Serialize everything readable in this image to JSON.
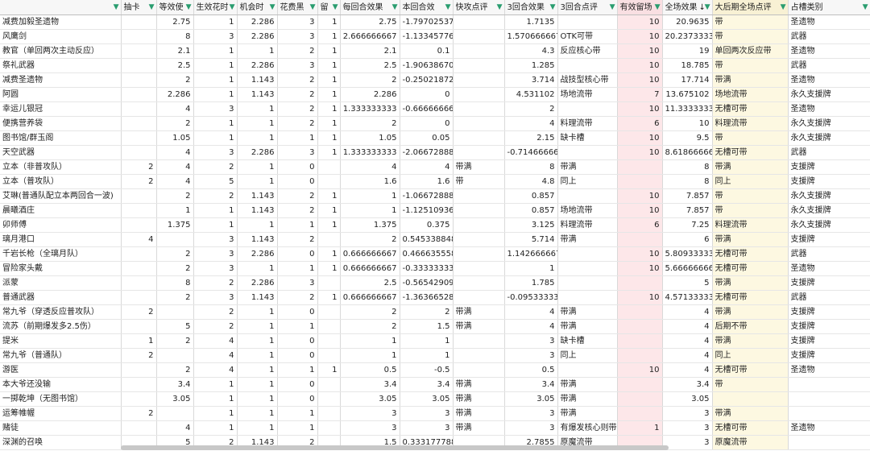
{
  "headers": [
    "",
    "抽卡",
    "等效使",
    "生效花时",
    "机会时",
    "花费黑",
    "留",
    "每回合效果",
    "本回合效",
    "快攻点评",
    "3回合效果",
    "3回合点评",
    "有效留场",
    "全场效果",
    "大后期全场点评",
    "占槽类别"
  ],
  "sort_indicator": "↓",
  "filter_icon": "▼",
  "rows": [
    [
      "减费加毅圣遗物",
      "",
      "2.75",
      "1",
      "2.286",
      "3",
      "1",
      "2.75",
      "-1.797025372",
      "",
      "1.7135",
      "",
      "10",
      "20.9635",
      "带",
      "圣遗物"
    ],
    [
      "风鹰剑",
      "",
      "8",
      "3",
      "2.286",
      "3",
      "1",
      "2.666666667",
      "-1.133457769",
      "",
      "1.570666667",
      "OTK可带",
      "10",
      "20.23733333",
      "带",
      "武器"
    ],
    [
      "教官（单回两次主动反应）",
      "",
      "2.1",
      "1",
      "1",
      "2",
      "1",
      "2.1",
      "0.1",
      "",
      "4.3",
      "反应核心带",
      "10",
      "19",
      "单回两次反应带",
      "圣遗物"
    ],
    [
      "祭礼武器",
      "",
      "2.5",
      "1",
      "2.286",
      "3",
      "1",
      "2.5",
      "-1.906386702",
      "",
      "1.285",
      "",
      "10",
      "18.785",
      "带",
      "武器"
    ],
    [
      "减费圣遗物",
      "",
      "2",
      "1",
      "1.143",
      "2",
      "1",
      "2",
      "-0.250218723",
      "",
      "3.714",
      "战技型核心带",
      "10",
      "17.714",
      "带满",
      "圣遗物"
    ],
    [
      "阿圆",
      "",
      "2.286",
      "1",
      "1.143",
      "2",
      "1",
      "2.286",
      "0",
      "",
      "4.531102",
      "场地流带",
      "7",
      "13.675102",
      "场地流带",
      "永久支援牌"
    ],
    [
      "幸运儿银冠",
      "",
      "4",
      "3",
      "1",
      "2",
      "1",
      "1.333333333",
      "-0.666666667",
      "",
      "2",
      "",
      "10",
      "11.33333333",
      "无槽可带",
      "圣遗物"
    ],
    [
      "便携营养袋",
      "",
      "2",
      "1",
      "1",
      "2",
      "1",
      "2",
      "0",
      "",
      "4",
      "料理流带",
      "6",
      "10",
      "料理流带",
      "永久支援牌"
    ],
    [
      "图书馆/群玉阁",
      "",
      "1.05",
      "1",
      "1",
      "1",
      "1",
      "1.05",
      "0.05",
      "",
      "2.15",
      "缺卡槽",
      "10",
      "9.5",
      "带",
      "永久支援牌"
    ],
    [
      "天空武器",
      "",
      "4",
      "3",
      "2.286",
      "3",
      "1",
      "1.333333333",
      "-2.066728885",
      "",
      "-0.714666667",
      "",
      "10",
      "8.618666667",
      "无槽可带",
      "武器"
    ],
    [
      "立本（非普攻队）",
      "2",
      "4",
      "2",
      "1",
      "0",
      "",
      "4",
      "4",
      "带满",
      "8",
      "带满",
      "",
      "8",
      "带满",
      "支援牌"
    ],
    [
      "立本（普攻队）",
      "2",
      "4",
      "5",
      "1",
      "0",
      "",
      "1.6",
      "1.6",
      "带",
      "4.8",
      "同上",
      "",
      "8",
      "同上",
      "支援牌"
    ],
    [
      "艾琳(普通队配立本两回合一波)",
      "",
      "2",
      "2",
      "1.143",
      "2",
      "1",
      "1",
      "-1.066728885",
      "",
      "0.857",
      "",
      "10",
      "7.857",
      "带",
      "永久支援牌"
    ],
    [
      "晨曦酒庄",
      "",
      "1",
      "1",
      "1.143",
      "2",
      "1",
      "1",
      "-1.125109361",
      "",
      "0.857",
      "场地流带",
      "10",
      "7.857",
      "带",
      "永久支援牌"
    ],
    [
      "卯师傅",
      "",
      "1.375",
      "1",
      "1",
      "1",
      "1",
      "1.375",
      "0.375",
      "",
      "3.125",
      "料理流带",
      "6",
      "7.25",
      "料理流带",
      "永久支援牌"
    ],
    [
      "璃月港口",
      "4",
      "",
      "3",
      "1.143",
      "2",
      "",
      "2",
      "0.545338848",
      "",
      "5.714",
      "带满",
      "",
      "6",
      "带满",
      "支援牌"
    ],
    [
      "千岩长枪（全璃月队）",
      "",
      "2",
      "3",
      "2.286",
      "0",
      "1",
      "0.666666667",
      "0.466635558",
      "",
      "1.142666667",
      "",
      "10",
      "5.809333333",
      "无槽可带",
      "武器"
    ],
    [
      "冒险家头戴",
      "",
      "2",
      "3",
      "1",
      "1",
      "1",
      "0.666666667",
      "-0.333333333",
      "",
      "1",
      "",
      "10",
      "5.666666667",
      "无槽可带",
      "圣遗物"
    ],
    [
      "派蒙",
      "",
      "8",
      "2",
      "2.286",
      "3",
      "",
      "2.5",
      "-0.565429093",
      "",
      "1.785",
      "",
      "",
      "5",
      "带满",
      "支援牌"
    ],
    [
      "普通武器",
      "",
      "2",
      "3",
      "1.143",
      "2",
      "1",
      "0.666666667",
      "-1.363665288",
      "",
      "-0.095333333",
      "",
      "10",
      "4.571333333",
      "无槽可带",
      "武器"
    ],
    [
      "常九爷（穿透反应普攻队）",
      "2",
      "",
      "2",
      "1",
      "0",
      "",
      "2",
      "2",
      "带满",
      "4",
      "带满",
      "",
      "4",
      "带满",
      "支援牌"
    ],
    [
      "流苏（前期爆发多2.5伤）",
      "",
      "5",
      "2",
      "1",
      "1",
      "",
      "2",
      "1.5",
      "带满",
      "4",
      "带满",
      "",
      "4",
      "后期不带",
      "支援牌"
    ],
    [
      "提米",
      "1",
      "2",
      "4",
      "1",
      "0",
      "",
      "1",
      "1",
      "",
      "3",
      "缺卡槽",
      "",
      "4",
      "带满",
      "支援牌"
    ],
    [
      "常九爷（普通队）",
      "2",
      "",
      "4",
      "1",
      "0",
      "",
      "1",
      "1",
      "",
      "3",
      "同上",
      "",
      "4",
      "同上",
      "支援牌"
    ],
    [
      "游医",
      "",
      "2",
      "4",
      "1",
      "1",
      "1",
      "0.5",
      "-0.5",
      "",
      "0.5",
      "",
      "10",
      "4",
      "无槽可带",
      "圣遗物"
    ],
    [
      "本大爷还没输",
      "",
      "3.4",
      "1",
      "1",
      "0",
      "",
      "3.4",
      "3.4",
      "带满",
      "3.4",
      "带满",
      "",
      "3.4",
      "带",
      ""
    ],
    [
      "一掷乾坤（无图书馆）",
      "",
      "3.05",
      "1",
      "1",
      "0",
      "",
      "3.05",
      "3.05",
      "带满",
      "3.05",
      "带满",
      "",
      "3.05",
      "",
      ""
    ],
    [
      "运筹帷幄",
      "2",
      "",
      "1",
      "1",
      "1",
      "",
      "3",
      "3",
      "带满",
      "3",
      "带满",
      "",
      "3",
      "带满",
      ""
    ],
    [
      "赌徒",
      "",
      "4",
      "1",
      "1",
      "1",
      "",
      "3",
      "3",
      "带满",
      "3",
      "有爆发核心则带",
      "1",
      "3",
      "无槽可带",
      "圣遗物"
    ],
    [
      "深渊的召唤",
      "",
      "5",
      "2",
      "1.143",
      "2",
      "",
      "1.5",
      "0.333177788",
      "",
      "2.7855",
      "原魔流带",
      "",
      "3",
      "原魔流带",
      ""
    ]
  ]
}
